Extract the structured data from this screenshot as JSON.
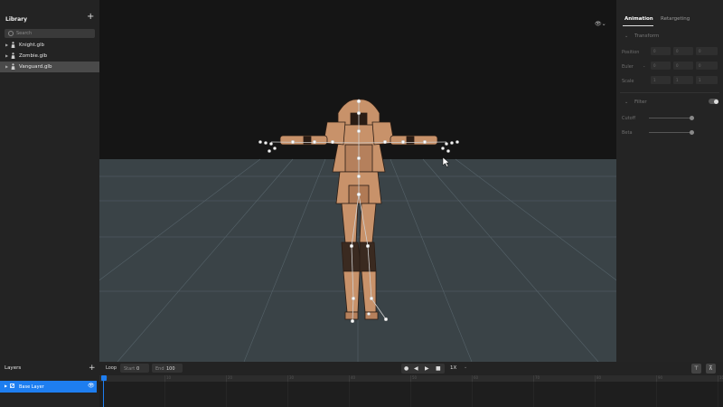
{
  "library": {
    "title": "Library",
    "add_icon": "plus-icon",
    "search_placeholder": "Search",
    "items": [
      {
        "label": "Knight.glb",
        "icon": "person-icon",
        "selected": false
      },
      {
        "label": "Zombie.glb",
        "icon": "person-icon",
        "selected": false
      },
      {
        "label": "Vanguard.glb",
        "icon": "person-icon",
        "selected": true
      }
    ]
  },
  "properties": {
    "tabs": [
      "Animation",
      "Retargeting"
    ],
    "active_tab": "Animation",
    "transform": {
      "title": "Transform",
      "rows": [
        {
          "label": "Position",
          "fields": [
            "0",
            "0",
            "0"
          ]
        },
        {
          "label": "Euler",
          "fields": [
            "0",
            "0",
            "0"
          ]
        },
        {
          "label": "Scale",
          "fields": [
            "1",
            "1",
            "1"
          ]
        }
      ]
    },
    "filter": {
      "title": "Filter",
      "enabled": false,
      "sliders": [
        {
          "label": "Cutoff",
          "value": 0.9
        },
        {
          "label": "Beta",
          "value": 0.9
        }
      ]
    }
  },
  "layers": {
    "title": "Layers",
    "items": [
      {
        "label": "Base Layer",
        "active": true
      }
    ]
  },
  "timeline": {
    "loop_label": "Loop",
    "start_label": "Start",
    "start_value": "0",
    "end_label": "End",
    "end_value": "100",
    "speed": "1X",
    "ruler_ticks": [
      "0",
      "10",
      "20",
      "30",
      "40",
      "50",
      "60",
      "70",
      "80",
      "90",
      "100"
    ]
  },
  "colors": {
    "accent": "#1e7ef0",
    "armor": "#c8926a",
    "ground": "#3a4347"
  },
  "icons": {
    "mode_button": "X",
    "camera": "camera-icon",
    "view": "eye-icon"
  }
}
